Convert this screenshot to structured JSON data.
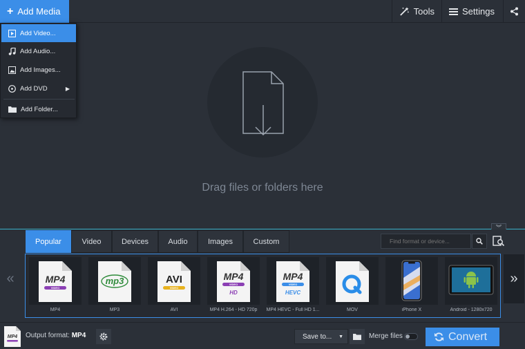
{
  "toolbar": {
    "add_media_label": "Add Media",
    "tools_label": "Tools",
    "settings_label": "Settings"
  },
  "menu": {
    "items": [
      {
        "label": "Add Video...",
        "icon": "video-file-icon"
      },
      {
        "label": "Add Audio...",
        "icon": "music-note-icon"
      },
      {
        "label": "Add Images...",
        "icon": "image-icon"
      },
      {
        "label": "Add DVD",
        "icon": "disc-icon"
      },
      {
        "label": "Add Folder...",
        "icon": "folder-icon"
      }
    ]
  },
  "dropzone": {
    "text": "Drag files or folders here"
  },
  "format_panel": {
    "tabs": [
      "Popular",
      "Video",
      "Devices",
      "Audio",
      "Images",
      "Custom"
    ],
    "active_tab": "Popular",
    "search_placeholder": "Find format or device...",
    "formats": [
      {
        "label": "MP4",
        "logo": "MP4",
        "band": "VIDEO"
      },
      {
        "label": "MP3",
        "logo": "mp3",
        "band": ""
      },
      {
        "label": "AVI",
        "logo": "AVI",
        "band": "VIDEO"
      },
      {
        "label": "MP4 H.264 - HD 720p",
        "logo": "MP4",
        "band": "VIDEO",
        "sub": "HD"
      },
      {
        "label": "MP4 HEVC - Full HD 1...",
        "logo": "MP4",
        "band": "VIDEO",
        "sub": "HEVC"
      },
      {
        "label": "MOV",
        "logo": "Q",
        "band": ""
      },
      {
        "label": "iPhone X",
        "logo": "",
        "band": ""
      },
      {
        "label": "Android - 1280x720",
        "logo": "",
        "band": ""
      }
    ]
  },
  "footer": {
    "output_format_label": "Output format:",
    "output_format_value": "MP4",
    "output_icon_text": "MP4",
    "save_to_label": "Save to...",
    "merge_label": "Merge files",
    "merge_enabled": false,
    "convert_label": "Convert"
  },
  "colors": {
    "accent": "#3b8ee8",
    "background": "#2b3038",
    "divider": "#3ab1c9"
  }
}
